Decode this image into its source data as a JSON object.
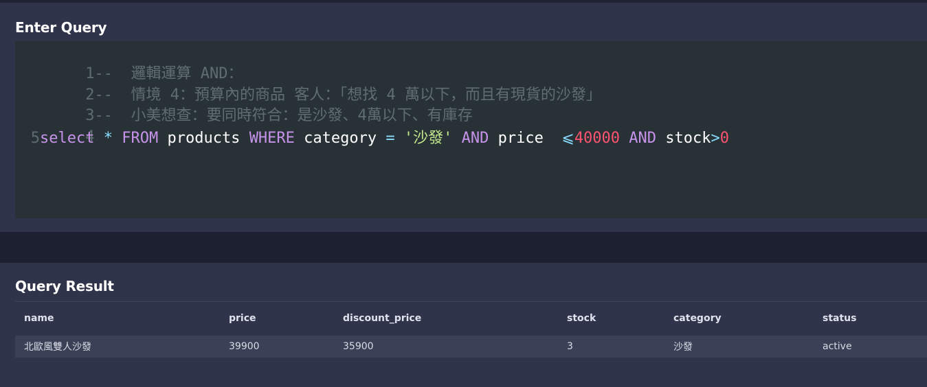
{
  "query_panel": {
    "title": "Enter Query",
    "lines": [
      {
        "num": "1",
        "comment": "--  邏輯運算 AND："
      },
      {
        "num": "2",
        "comment": "--  情境 4：預算內的商品 客人：「想找 4 萬以下，而且有現貨的沙發」"
      },
      {
        "num": "3",
        "comment": "--  小美想查：要同時符合：是沙發、4萬以下、有庫存"
      },
      {
        "num": "4",
        "comment": ""
      },
      {
        "num": "5"
      }
    ],
    "sql": {
      "select": "select",
      "star": "*",
      "from": "FROM",
      "table": "products",
      "where": "WHERE",
      "col_category": "category",
      "eq": "=",
      "category_value": "'沙發'",
      "and1": "AND",
      "col_price": "price",
      "lte": "⩽",
      "price_value": "40000",
      "and2": "AND",
      "col_stock": "stock",
      "gt": ">",
      "stock_value": "0"
    }
  },
  "result_panel": {
    "title": "Query Result",
    "columns": [
      "name",
      "price",
      "discount_price",
      "stock",
      "category",
      "status"
    ],
    "rows": [
      [
        "北歐風雙人沙發",
        "39900",
        "35900",
        "3",
        "沙發",
        "active"
      ]
    ]
  },
  "colors": {
    "keyword": "#c792ea",
    "operator": "#89ddff",
    "string": "#c3e88d",
    "number": "#ff5370",
    "comment": "#5f6d72"
  }
}
